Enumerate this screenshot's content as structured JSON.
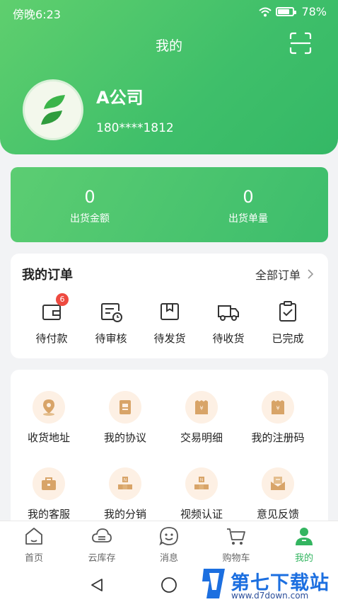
{
  "status_bar": {
    "time": "傍晚6:23",
    "battery": "78%"
  },
  "header": {
    "title": "我的"
  },
  "profile": {
    "name": "A公司",
    "phone": "180****1812"
  },
  "stats": [
    {
      "value": "0",
      "label": "出货金额"
    },
    {
      "value": "0",
      "label": "出货单量"
    }
  ],
  "orders": {
    "title": "我的订单",
    "view_all": "全部订单",
    "items": [
      {
        "label": "待付款",
        "icon": "wallet-icon",
        "badge": "6"
      },
      {
        "label": "待审核",
        "icon": "calendar-clock-icon"
      },
      {
        "label": "待发货",
        "icon": "box-icon"
      },
      {
        "label": "待收货",
        "icon": "truck-icon"
      },
      {
        "label": "已完成",
        "icon": "clipboard-check-icon"
      }
    ]
  },
  "tools": [
    {
      "label": "收货地址",
      "icon": "location-pin-icon"
    },
    {
      "label": "我的协议",
      "icon": "document-icon"
    },
    {
      "label": "交易明细",
      "icon": "receipt-icon"
    },
    {
      "label": "我的注册码",
      "icon": "receipt-icon"
    },
    {
      "label": "我的客服",
      "icon": "briefcase-icon"
    },
    {
      "label": "我的分销",
      "icon": "distribution-icon"
    },
    {
      "label": "视频认证",
      "icon": "distribution-icon"
    },
    {
      "label": "意见反馈",
      "icon": "feedback-mail-icon"
    }
  ],
  "tabbar": [
    {
      "label": "首页",
      "icon": "home-icon"
    },
    {
      "label": "云库存",
      "icon": "cloud-icon"
    },
    {
      "label": "消息",
      "icon": "message-icon"
    },
    {
      "label": "购物车",
      "icon": "cart-icon"
    },
    {
      "label": "我的",
      "icon": "user-icon",
      "active": true
    }
  ],
  "watermark": {
    "text": "第七下载站",
    "url": "www.d7down.com"
  },
  "colors": {
    "primary_green": "#3fbf6a",
    "badge_red": "#ee4a40",
    "tool_icon_bg": "#fdf0e4",
    "tool_icon_fg": "#d8a468"
  }
}
